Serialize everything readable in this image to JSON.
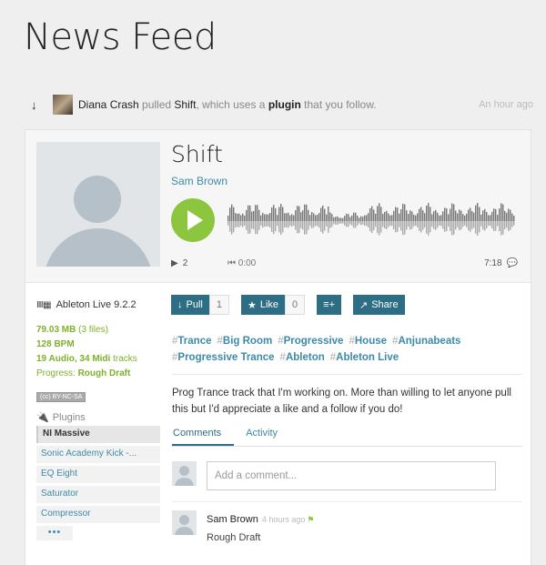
{
  "page": {
    "title": "News Feed"
  },
  "activity": {
    "user": "Diana Crash",
    "verb": "pulled",
    "track": "Shift",
    "middle": ", which uses a",
    "object": "plugin",
    "tail": "that you follow.",
    "time": "An hour ago"
  },
  "track": {
    "title": "Shift",
    "artist": "Sam Brown",
    "plays": "2",
    "position": "0:00",
    "duration": "7:18"
  },
  "meta": {
    "daw": "Ableton Live 9.2.2",
    "size": "79.03 MB",
    "files": "(3 files)",
    "bpm": "128 BPM",
    "audio_midi": "19 Audio, 34 Midi",
    "tracks_word": "tracks",
    "progress_label": "Progress:",
    "progress_value": "Rough Draft",
    "license": "BY-NC-SA"
  },
  "plugins": {
    "header": "Plugins",
    "items": [
      "NI Massive",
      "Sonic Academy Kick -...",
      "EQ Eight",
      "Saturator",
      "Compressor"
    ],
    "more": "•••"
  },
  "actions": {
    "pull_label": "Pull",
    "pull_count": "1",
    "like_label": "Like",
    "like_count": "0",
    "share_label": "Share"
  },
  "tags": [
    "Trance",
    "Big Room",
    "Progressive",
    "House",
    "Anjunabeats",
    "Progressive Trance",
    "Ableton",
    "Ableton Live"
  ],
  "description": "Prog Trance track that I'm working on. More than willing to let anyone pull this but I'd appreciate a like and a follow if you do!",
  "tabs": [
    "Comments",
    "Activity"
  ],
  "comment_placeholder": "Add a comment...",
  "comments": [
    {
      "author": "Sam Brown",
      "time": "4 hours ago",
      "text": "Rough Draft"
    }
  ],
  "colors": {
    "accent": "#2e6e84",
    "link": "#3d8aa8",
    "play": "#8cc63f",
    "green_text": "#7fb02b"
  },
  "icons": [
    "down-arrow-icon",
    "play-icon",
    "speech-bubble-icon",
    "plus-list-icon",
    "share-icon",
    "plug-icon",
    "thumbs-up-icon"
  ]
}
